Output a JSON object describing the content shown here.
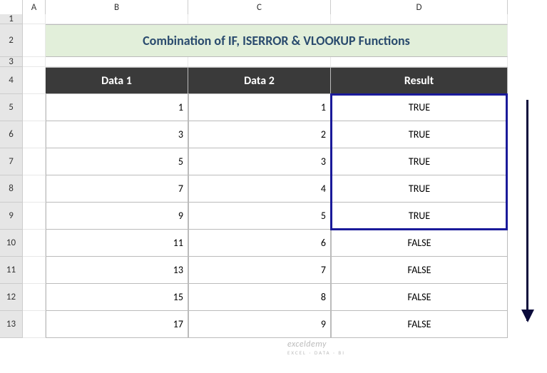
{
  "columns": [
    "A",
    "B",
    "C",
    "D"
  ],
  "rowNumbers": [
    "1",
    "2",
    "3",
    "4",
    "5",
    "6",
    "7",
    "8",
    "9",
    "10",
    "11",
    "12",
    "13"
  ],
  "title": "Combination of IF, ISERROR & VLOOKUP  Functions",
  "headers": {
    "b": "Data 1",
    "c": "Data 2",
    "d": "Result"
  },
  "rows": [
    {
      "b": "1",
      "c": "1",
      "d": "TRUE"
    },
    {
      "b": "3",
      "c": "2",
      "d": "TRUE"
    },
    {
      "b": "5",
      "c": "3",
      "d": "TRUE"
    },
    {
      "b": "7",
      "c": "4",
      "d": "TRUE"
    },
    {
      "b": "9",
      "c": "5",
      "d": "TRUE"
    },
    {
      "b": "11",
      "c": "6",
      "d": "FALSE"
    },
    {
      "b": "13",
      "c": "7",
      "d": "FALSE"
    },
    {
      "b": "15",
      "c": "8",
      "d": "FALSE"
    },
    {
      "b": "17",
      "c": "9",
      "d": "FALSE"
    }
  ],
  "watermark": {
    "main": "exceldemy",
    "sub": "EXCEL · DATA · BI"
  },
  "chart_data": {
    "type": "table",
    "title": "Combination of IF, ISERROR & VLOOKUP  Functions",
    "columns": [
      "Data 1",
      "Data 2",
      "Result"
    ],
    "rows": [
      [
        1,
        1,
        "TRUE"
      ],
      [
        3,
        2,
        "TRUE"
      ],
      [
        5,
        3,
        "TRUE"
      ],
      [
        7,
        4,
        "TRUE"
      ],
      [
        9,
        5,
        "TRUE"
      ],
      [
        11,
        6,
        "FALSE"
      ],
      [
        13,
        7,
        "FALSE"
      ],
      [
        15,
        8,
        "FALSE"
      ],
      [
        17,
        9,
        "FALSE"
      ]
    ]
  }
}
